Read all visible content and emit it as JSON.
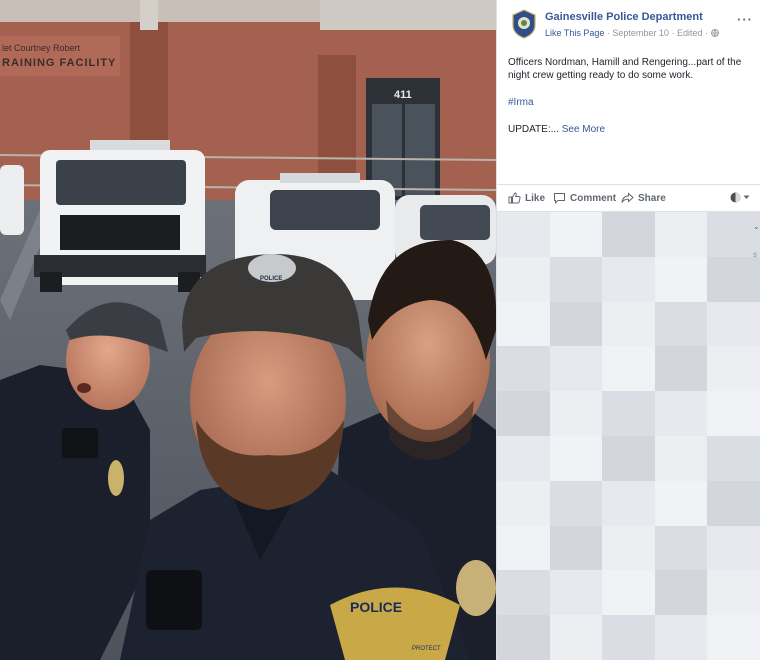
{
  "photo": {
    "sign_line1": "let Courtney Robert",
    "sign_line2": "RAINING FACILITY",
    "door_number": "411",
    "cap_label": "POLICE",
    "patch_label": "POLICE",
    "patch_sub": "PROTECT",
    "alt": "Three police officers taking a selfie in front of patrol cars"
  },
  "header": {
    "page_name": "Gainesville Police Department",
    "like_link": "Like This Page",
    "sep": "·",
    "date": "September 10",
    "edited": "Edited",
    "more_label": "···"
  },
  "post": {
    "text": "Officers Nordman, Hamill and Rengering...part of the night crew getting ready to do some work.",
    "hashtag": "#Irma",
    "update_prefix": "UPDATE:... ",
    "see_more": "See More"
  },
  "actions": {
    "like": "Like",
    "comment": "Comment",
    "share": "Share"
  },
  "side_glyphs": {
    "caret": "⌄",
    "s": "s"
  },
  "colors": {
    "link": "#365899",
    "meta": "#90949c",
    "text": "#1d2129",
    "action": "#606770",
    "uniform": "#1b1f2b",
    "brick": "#a4614f"
  }
}
